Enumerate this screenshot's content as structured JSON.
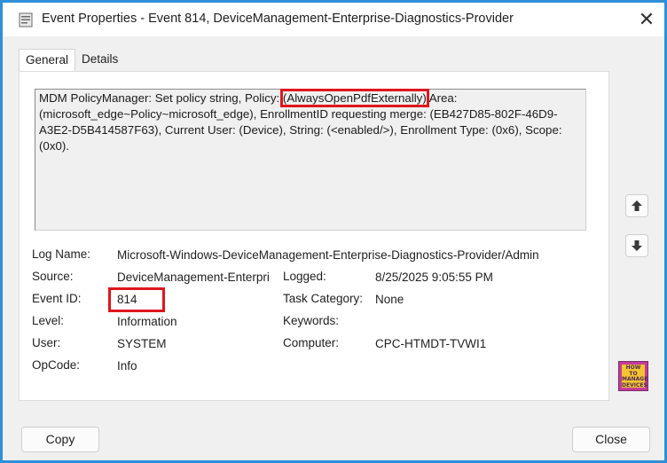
{
  "window": {
    "title": "Event Properties - Event 814, DeviceManagement-Enterprise-Diagnostics-Provider",
    "close_glyph": "✕",
    "icon": "event-viewer-icon"
  },
  "tabs": [
    {
      "label": "General",
      "active": true
    },
    {
      "label": "Details",
      "active": false
    }
  ],
  "message": {
    "prefix": "MDM PolicyManager: Set policy string, Policy: ",
    "highlight": "(AlwaysOpenPdfExternally)",
    "suffix": " Area: (microsoft_edge~Policy~microsoft_edge), EnrollmentID requesting merge: (EB427D85-802F-46D9-A3E2-D5B414587F63), Current User: (Device), String: (<enabled/>), Enrollment Type: (0x6), Scope: (0x0)."
  },
  "fields": {
    "log_name_label": "Log Name:",
    "log_name_value": "Microsoft-Windows-DeviceManagement-Enterprise-Diagnostics-Provider/Admin",
    "source_label": "Source:",
    "source_value": "DeviceManagement-Enterpri",
    "logged_label": "Logged:",
    "logged_value": "8/25/2025 9:05:55 PM",
    "event_id_label": "Event ID:",
    "event_id_value": "814",
    "task_category_label": "Task Category:",
    "task_category_value": "None",
    "level_label": "Level:",
    "level_value": "Information",
    "keywords_label": "Keywords:",
    "keywords_value": "",
    "user_label": "User:",
    "user_value": "SYSTEM",
    "computer_label": "Computer:",
    "computer_value": "CPC-HTMDT-TVWI1",
    "opcode_label": "OpCode:",
    "opcode_value": "Info"
  },
  "nav": {
    "up_icon": "arrow-up-icon",
    "down_icon": "arrow-down-icon"
  },
  "logo": {
    "line1": "HOW TO",
    "line2": "MANAGE",
    "line3": "DEVICES"
  },
  "buttons": {
    "copy": "Copy",
    "close": "Close"
  },
  "colors": {
    "highlight": "#e0161e",
    "window_border": "#2f8fd8"
  }
}
